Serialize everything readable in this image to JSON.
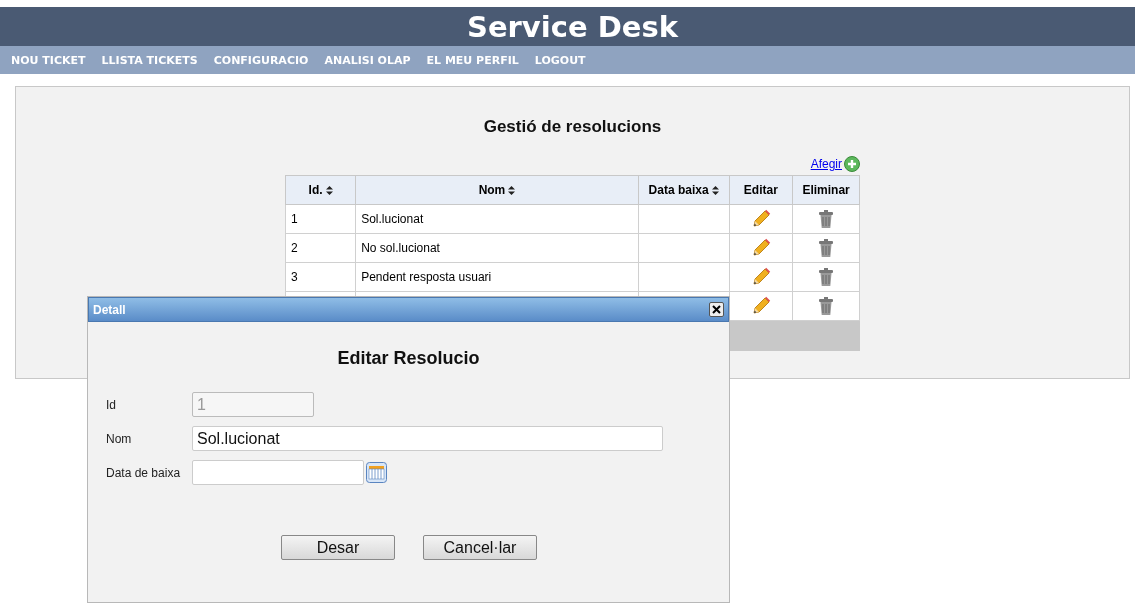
{
  "header": {
    "title": "Service Desk"
  },
  "nav": [
    "NOU TICKET",
    "LLISTA TICKETS",
    "CONFIGURACIO",
    "ANALISI OLAP",
    "EL MEU PERFIL",
    "LOGOUT"
  ],
  "page": {
    "title": "Gestió de resolucions",
    "add_link": "Afegir"
  },
  "table": {
    "columns": [
      {
        "label": "Id.",
        "sortable": true
      },
      {
        "label": "Nom",
        "sortable": true
      },
      {
        "label": "Data baixa",
        "sortable": true
      },
      {
        "label": "Editar",
        "sortable": false
      },
      {
        "label": "Eliminar",
        "sortable": false
      }
    ],
    "rows": [
      {
        "id": "1",
        "name": "Sol.lucionat"
      },
      {
        "id": "2",
        "name": "No sol.lucionat"
      },
      {
        "id": "3",
        "name": "Pendent resposta usuari"
      },
      {}
    ]
  },
  "dialog": {
    "title": "Detall",
    "heading": "Editar Resolucio",
    "fields": [
      {
        "label": "Id",
        "value": "1",
        "disabled": true,
        "kind": "short"
      },
      {
        "label": "Nom",
        "value": "Sol.lucionat",
        "disabled": false,
        "kind": "long"
      },
      {
        "label": "Data de baixa",
        "disabled": false,
        "kind": "date"
      }
    ],
    "buttons": [
      "Desar",
      "Cancel·lar"
    ]
  }
}
